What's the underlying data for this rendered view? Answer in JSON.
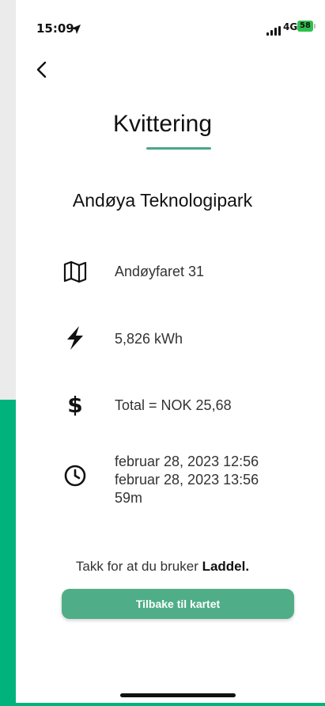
{
  "status_bar": {
    "time": "15:09",
    "network": "4G",
    "battery": "58",
    "icons": [
      "location-arrow-icon",
      "signal-bars-icon",
      "battery-icon"
    ]
  },
  "nav": {
    "back_icon": "chevron-left-icon"
  },
  "receipt": {
    "title": "Kvittering",
    "station": "Andøya Teknologipark",
    "address": {
      "icon": "map-icon",
      "text": "Andøyfaret 31"
    },
    "energy": {
      "icon": "lightning-icon",
      "text": "5,826 kWh"
    },
    "total": {
      "icon": "dollar-icon",
      "text": "Total = NOK  25,68"
    },
    "time": {
      "icon": "clock-icon",
      "start": "februar 28, 2023 12:56",
      "end": "februar 28, 2023 13:56",
      "duration": "59m"
    }
  },
  "footer": {
    "thanks_prefix": "Takk for at du bruker ",
    "brand": "Laddel.",
    "button_label": "Tilbake til kartet"
  },
  "colors": {
    "accent": "#48a885",
    "button": "#4fae88",
    "background_strip": "#00b37c",
    "battery": "#2ec04e"
  }
}
